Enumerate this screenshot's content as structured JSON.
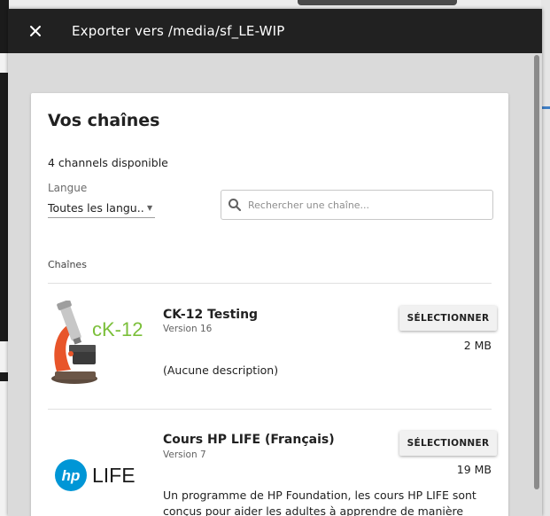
{
  "dialog": {
    "title": "Exporter vers /media/sf_LE-WIP",
    "close_icon": "close-icon"
  },
  "card": {
    "heading": "Vos chaînes",
    "count_text": "4 channels disponible",
    "language": {
      "label": "Langue",
      "selected": "Toutes les langu..."
    },
    "search": {
      "placeholder": "Rechercher une chaîne..."
    },
    "section_label": "Chaînes"
  },
  "channels": [
    {
      "name": "CK-12 Testing",
      "version": "Version 16",
      "description": "(Aucune description)",
      "button_label": "SÉLECTIONNER",
      "size": "2 MB",
      "logo_text": "cK-12"
    },
    {
      "name": "Cours HP LIFE (Français)",
      "version": "Version 7",
      "description": "Un programme de HP Foundation, les cours HP LIFE sont conçus pour aider les adultes à apprendre de manière",
      "button_label": "SÉLECTIONNER",
      "size": "19 MB",
      "logo_text_hp": "hp",
      "logo_text_life": "LIFE"
    }
  ],
  "colors": {
    "titlebar": "#212121",
    "hp_blue": "#0096d6",
    "ck12_green": "#7bbf3a",
    "microscope_orange": "#e8552a"
  }
}
